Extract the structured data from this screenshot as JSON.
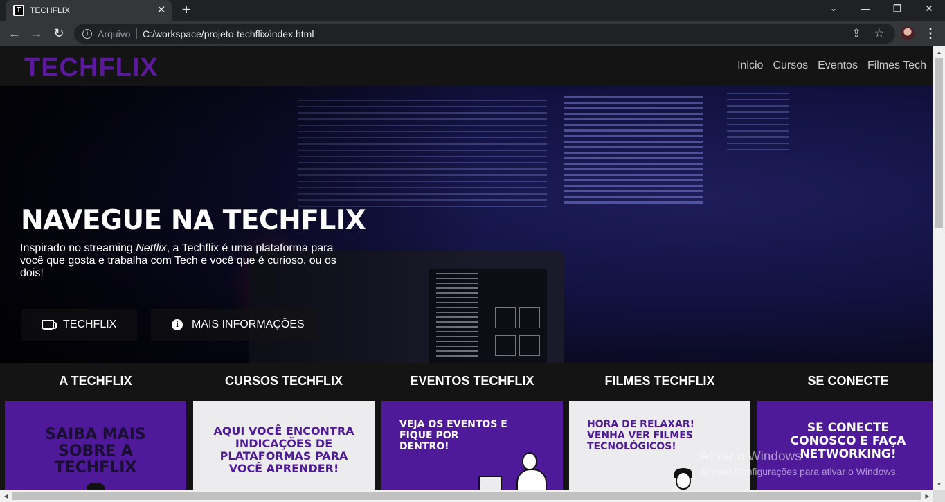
{
  "browser": {
    "tab_title": "TECHFLIX",
    "tab_close": "✕",
    "new_tab": "+",
    "minimize": "—",
    "restore": "❐",
    "close": "✕",
    "back": "←",
    "forward": "→",
    "reload": "↻",
    "url_scheme": "Arquivo",
    "url": "C:/workspace/projeto-techflix/index.html",
    "share": "⇪",
    "bookmark": "☆",
    "menu": "⋮"
  },
  "header": {
    "logo": "TECHFLIX",
    "nav": [
      "Inicio",
      "Cursos",
      "Eventos",
      "Filmes Tech"
    ]
  },
  "hero": {
    "title": "NAVEGUE NA TECHFLIX",
    "text_before": "Inspirado no streaming ",
    "text_em": "Netflix",
    "text_after": ", a Techflix é uma plataforma para você que gosta e trabalha com Tech e você que é curioso, ou os dois!",
    "btn_primary": "TECHFLIX",
    "btn_secondary": "MAIS INFORMAÇÕES",
    "info_glyph": "i"
  },
  "cards": [
    {
      "title": "A TECHFLIX",
      "text": "SAIBA MAIS SOBRE A TECHFLIX",
      "theme": "purple"
    },
    {
      "title": "CURSOS TECHFLIX",
      "text": "AQUI VOCÊ ENCONTRA INDICAÇÕES DE PLATAFORMAS PARA VOCÊ APRENDER!",
      "theme": "light"
    },
    {
      "title": "EVENTOS TECHFLIX",
      "text": "VEJA OS EVENTOS E FIQUE POR DENTRO!",
      "theme": "purple"
    },
    {
      "title": "FILMES TECHFLIX",
      "text": "HORA DE RELAXAR! VENHA VER FILMES TECNOLÓGICOS!",
      "theme": "light"
    },
    {
      "title": "SE CONECTE",
      "text": "SE CONECTE CONOSCO E FAÇA NETWORKING!",
      "theme": "purple"
    }
  ],
  "watermark": {
    "line1": "Ativar o Windows",
    "line2": "Acesse Configurações para ativar o Windows."
  },
  "scrollbar": {
    "up": "▲",
    "down": "▼",
    "left": "◀",
    "right": "▶"
  },
  "colors": {
    "brand_purple": "#5b1a9e",
    "card_purple": "#4f1a99",
    "card_light": "#ececee",
    "page_bg": "#141414"
  }
}
